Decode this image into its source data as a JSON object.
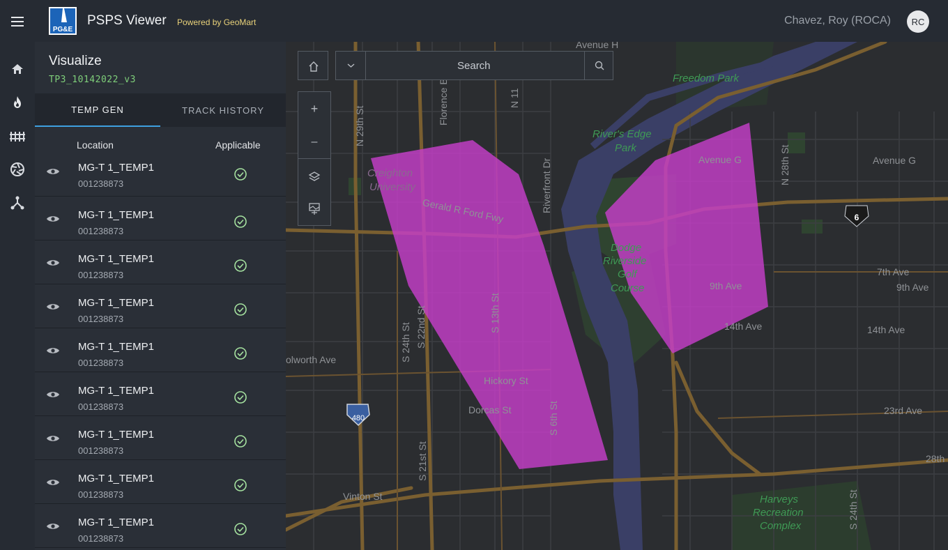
{
  "header": {
    "app_title": "PSPS Viewer",
    "powered_by": "Powered by GeoMart",
    "user_name": "Chavez, Roy (ROCA)",
    "user_initials": "RC",
    "logo_text": "PG&E"
  },
  "rail": {
    "icons": [
      "home-icon",
      "fire-icon",
      "substation-icon",
      "aperture-icon",
      "network-icon"
    ]
  },
  "panel": {
    "title": "Visualize",
    "subtitle": "TP3_10142022_v3",
    "tabs": [
      {
        "label": "TEMP GEN",
        "active": true
      },
      {
        "label": "TRACK HISTORY",
        "active": false
      }
    ],
    "columns": {
      "location": "Location",
      "applicable": "Applicable"
    },
    "rows": [
      {
        "name": "MG-T 1_TEMP1",
        "id": "001238873",
        "applicable": true
      },
      {
        "name": "MG-T 1_TEMP1",
        "id": "001238873",
        "applicable": true
      },
      {
        "name": "MG-T 1_TEMP1",
        "id": "001238873",
        "applicable": true
      },
      {
        "name": "MG-T 1_TEMP1",
        "id": "001238873",
        "applicable": true
      },
      {
        "name": "MG-T 1_TEMP1",
        "id": "001238873",
        "applicable": true
      },
      {
        "name": "MG-T 1_TEMP1",
        "id": "001238873",
        "applicable": true
      },
      {
        "name": "MG-T 1_TEMP1",
        "id": "001238873",
        "applicable": true
      },
      {
        "name": "MG-T 1_TEMP1",
        "id": "001238873",
        "applicable": true
      },
      {
        "name": "MG-T 1_TEMP1",
        "id": "001238873",
        "applicable": true
      }
    ]
  },
  "map": {
    "search_placeholder": "Search",
    "zoom_in": "+",
    "zoom_out": "–",
    "highway_480": "480",
    "highway_6": "6",
    "labels": {
      "avenue_h": "Avenue H",
      "freedom_park": "Freedom Park",
      "n_29th": "N 29th St",
      "florence": "Florence B",
      "n_11": "N 11",
      "rivers_edge_1": "River's Edge",
      "rivers_edge_2": "Park",
      "n_28th": "N 28th St",
      "avenue_g_1": "Avenue G",
      "avenue_g_2": "Avenue G",
      "creighton_1": "Creighton",
      "creighton_2": "University",
      "gerald_ford": "Gerald R Ford Fwy",
      "riverfront": "Riverfront Dr",
      "dodge_1": "Dodge",
      "dodge_2": "Riverside",
      "dodge_3": "Golf",
      "dodge_4": "Course",
      "seventh_ave": "7th Ave",
      "ninth_ave_1": "9th Ave",
      "ninth_ave_2": "9th Ave",
      "s_13th": "S 13th St",
      "s_22nd": "S 22nd St",
      "s_24th": "S 24th St",
      "fourteenth_1": "14th Ave",
      "fourteenth_2": "14th Ave",
      "woolworth": "olworth Ave",
      "hickory": "Hickory St",
      "dorcas": "Dorcas St",
      "s_6th": "S 6th St",
      "s_21st": "S 21st St",
      "twentythird": "23rd Ave",
      "twentyeighth": "28th",
      "vinton": "Vinton St",
      "harveys_1": "Harveys",
      "harveys_2": "Recreation",
      "harveys_3": "Complex",
      "s_24th_right": "S 24th St"
    },
    "colors": {
      "polygon_fill": "#c63ec9",
      "road": "#7a5f30",
      "river": "#3a3f66",
      "park": "#2f4430"
    }
  }
}
